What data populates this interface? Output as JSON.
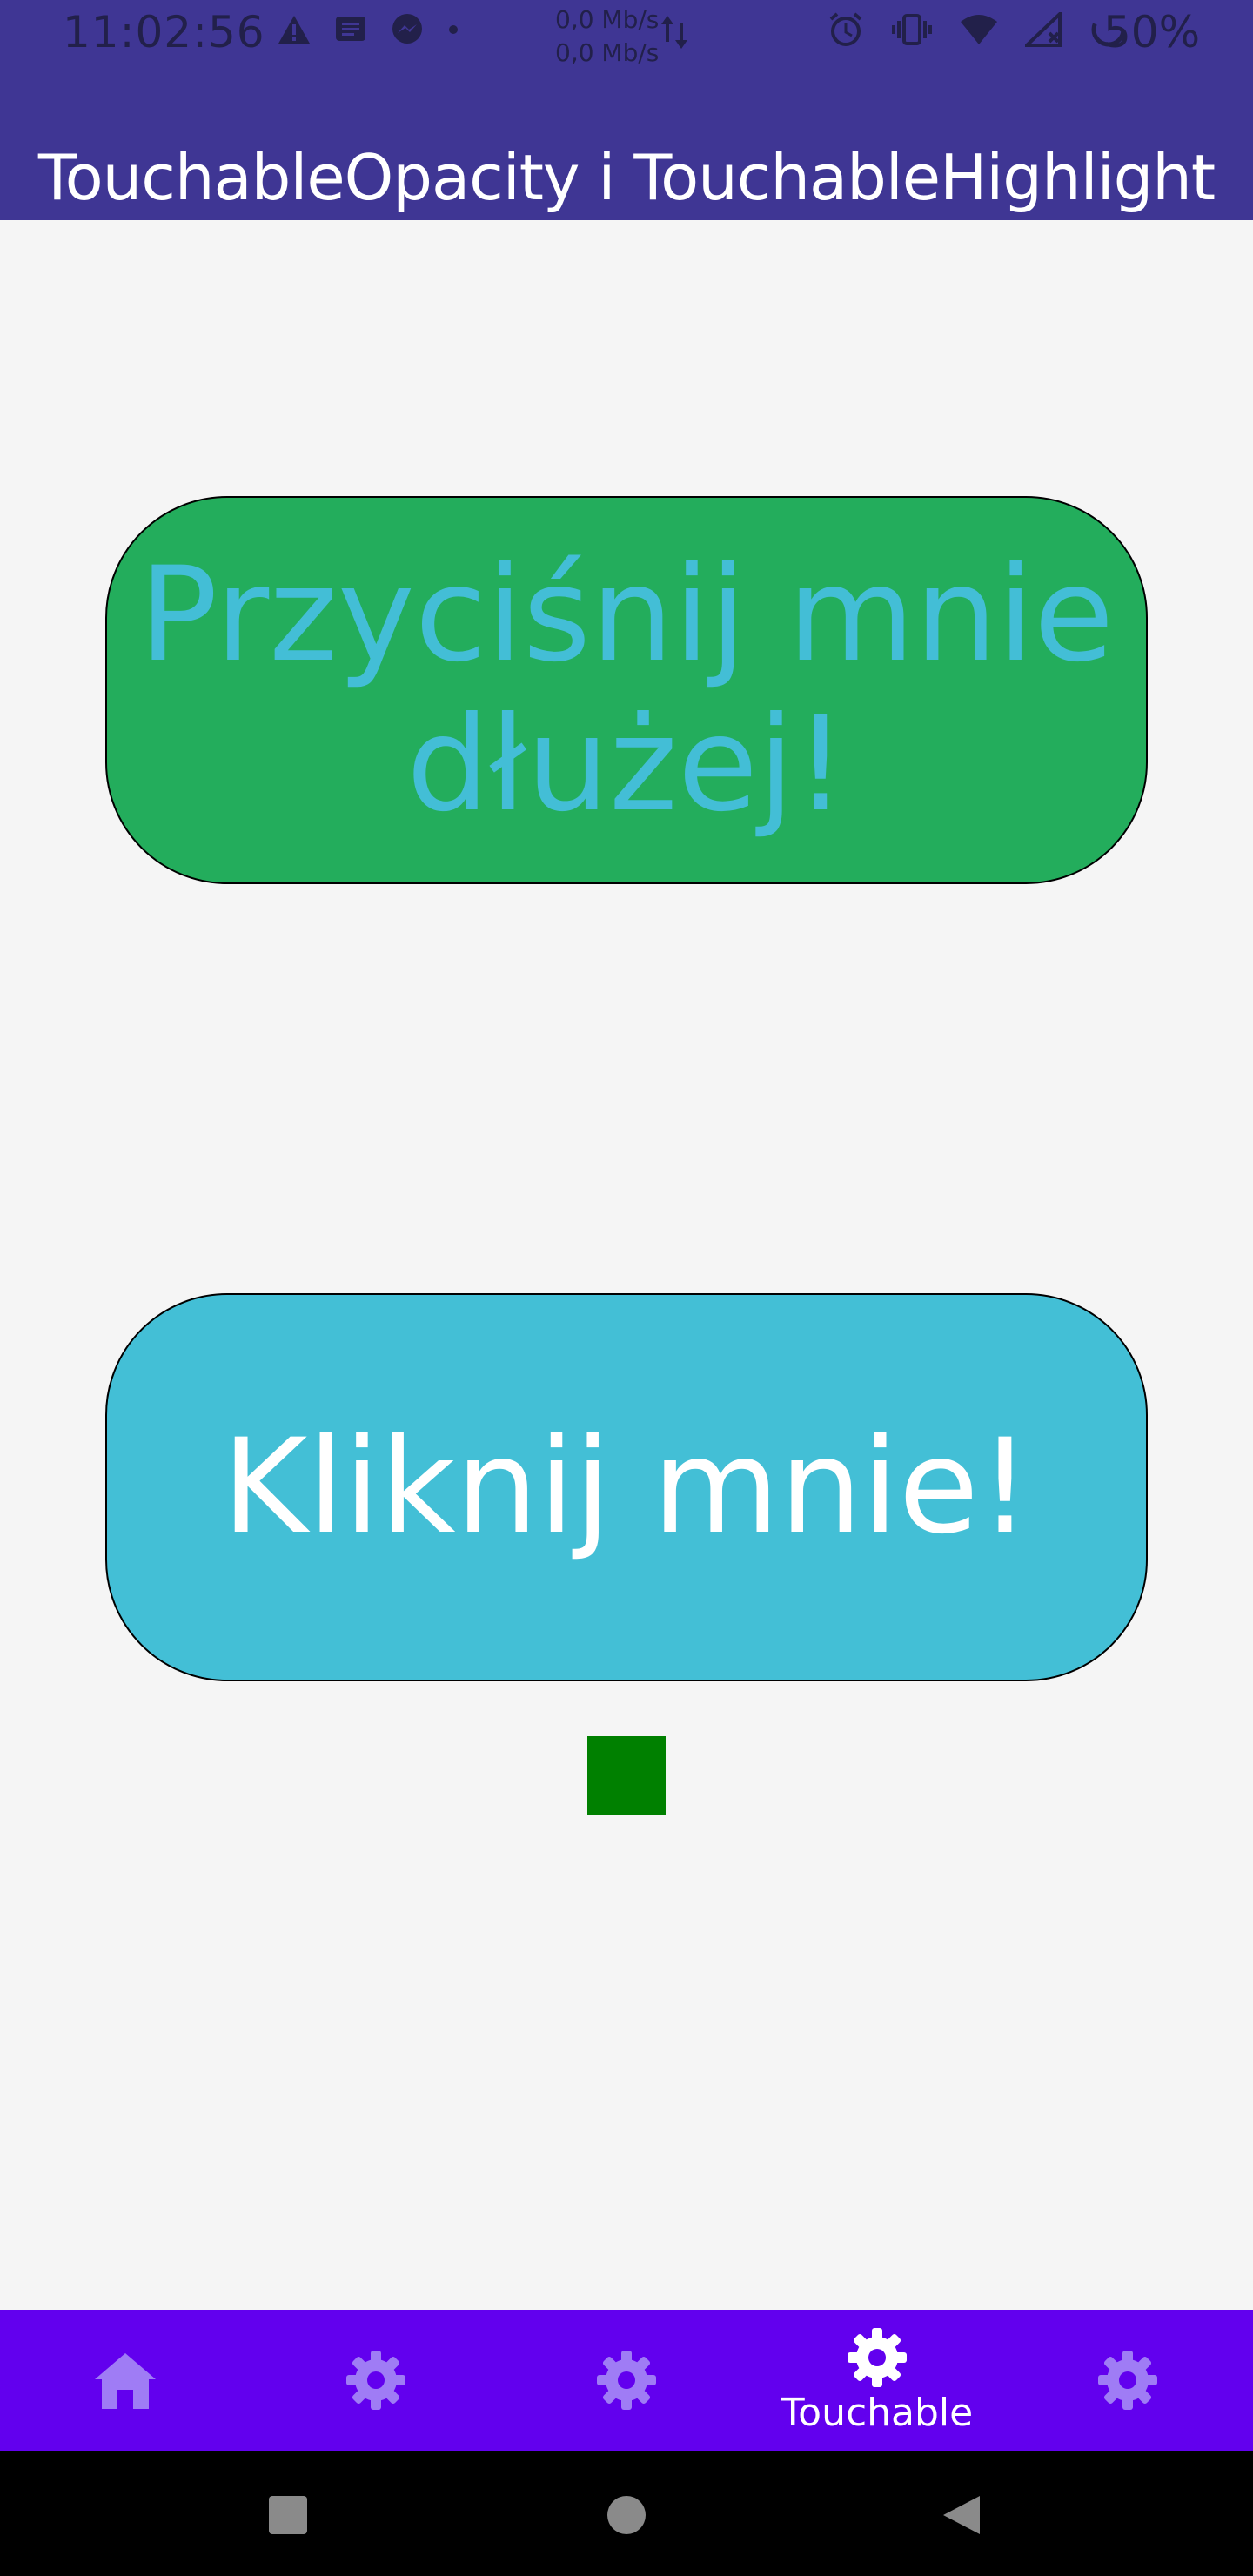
{
  "status_bar": {
    "time": "11:02:56",
    "net_speed_up": "0,0 Mb/s",
    "net_speed_down": "0,0 Mb/s",
    "battery": "50%"
  },
  "header": {
    "title": "TouchableOpacity i TouchableHighlight"
  },
  "main": {
    "long_press_button": {
      "line1": "Przyciśnij mnie",
      "line2": "dłużej!"
    },
    "click_button": {
      "label": "Kliknij mnie!"
    },
    "indicator_color": "#008000"
  },
  "tab_bar": {
    "tabs": [
      {
        "icon": "home-icon",
        "label": "",
        "active": false
      },
      {
        "icon": "gear-icon",
        "label": "",
        "active": false
      },
      {
        "icon": "gear-icon",
        "label": "",
        "active": false
      },
      {
        "icon": "gear-icon",
        "label": "Touchable",
        "active": true
      },
      {
        "icon": "gear-icon",
        "label": "",
        "active": false
      }
    ]
  },
  "colors": {
    "header_bg": "#3f3694",
    "long_press_bg": "#23ad5c",
    "long_press_text": "#43bed6",
    "click_bg": "#43bfd6",
    "tabbar_bg": "#6200ee",
    "tab_inactive": "#9f7cf5",
    "tab_active": "#ffffff"
  }
}
